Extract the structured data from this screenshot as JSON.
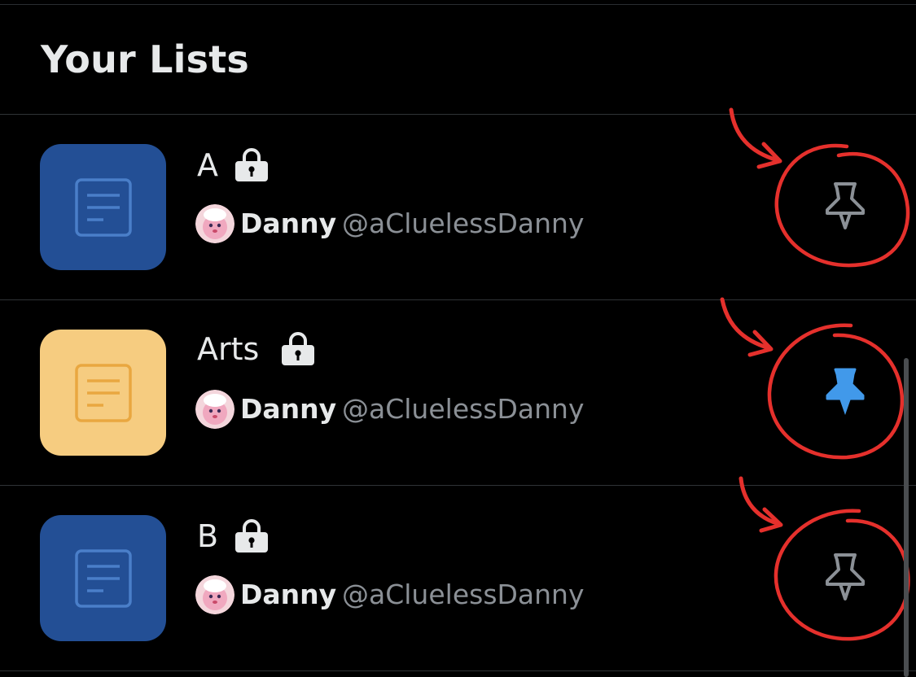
{
  "header": {
    "title": "Your Lists"
  },
  "lists": [
    {
      "name": "A",
      "private": true,
      "pinned": false,
      "thumb_color": "#234f95",
      "thumb_icon_color": "#4a7fc9",
      "owner": {
        "name": "Danny",
        "handle": "@aCluelessDanny"
      }
    },
    {
      "name": "Arts",
      "private": true,
      "pinned": true,
      "thumb_color": "#f6cc80",
      "thumb_icon_color": "#e9a740",
      "owner": {
        "name": "Danny",
        "handle": "@aCluelessDanny"
      }
    },
    {
      "name": "B",
      "private": true,
      "pinned": false,
      "thumb_color": "#234f95",
      "thumb_icon_color": "#4a7fc9",
      "owner": {
        "name": "Danny",
        "handle": "@aCluelessDanny"
      }
    }
  ],
  "icons": {
    "thumb": "list-document-icon",
    "privacy": "lock-icon",
    "pin": "pin-icon"
  },
  "colors": {
    "pin_active": "#4199ea",
    "pin_inactive": "#8b9096",
    "annotation": "#e5302c"
  }
}
